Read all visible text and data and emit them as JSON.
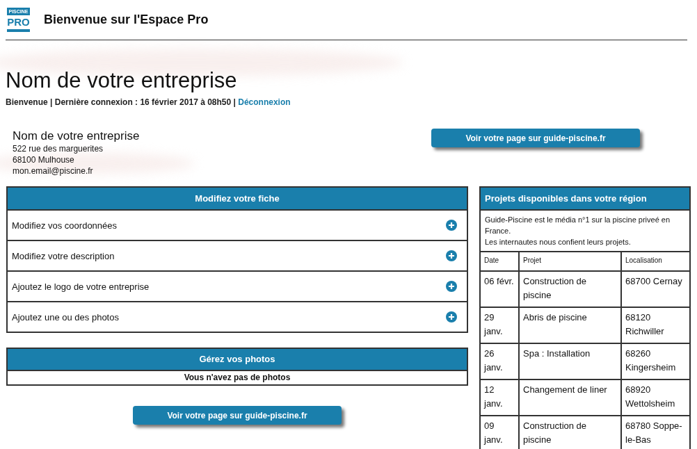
{
  "logo": {
    "top": "PISCINE",
    "bottom": "PRO"
  },
  "header": {
    "title": "Bienvenue sur l'Espace Pro"
  },
  "page": {
    "title": "Nom de votre entreprise",
    "login_info": "Bienvenue | Dernière connexion : 16 février 2017 à 08h50 |",
    "logout": "Déconnexion"
  },
  "view_button_top": "Voir votre page sur guide-piscine.fr",
  "company": {
    "name": "Nom de votre entreprise",
    "address": "522 rue des marguerites",
    "city": "68100 Mulhouse",
    "email": "mon.email@piscine.fr"
  },
  "fiche": {
    "title": "Modifiez votre fiche",
    "items": [
      {
        "label": "Modifiez vos coordonnées"
      },
      {
        "label": "Modifiez votre description"
      },
      {
        "label": "Ajoutez le logo de votre entreprise"
      },
      {
        "label": "Ajoutez une ou des photos"
      }
    ]
  },
  "photos": {
    "title": "Gérez vos photos",
    "message": "Vous n'avez pas de photos"
  },
  "view_button_bottom": "Voir votre page sur guide-piscine.fr",
  "projects": {
    "title": "Projets disponibles dans votre région",
    "intro": [
      "Guide-Piscine est le média n°1 sur la piscine priveé en France.",
      "Les internautes nous confient leurs projets."
    ],
    "columns": [
      "Date",
      "Projet",
      "Localisation"
    ],
    "rows": [
      [
        "06 févr.",
        "Construction de piscine",
        "68700 Cernay"
      ],
      [
        "29 janv.",
        "Abris de piscine",
        "68120 Richwiller"
      ],
      [
        "26 janv.",
        "Spa : Installation",
        "68260 Kingersheim"
      ],
      [
        "12 janv.",
        "Changement de liner",
        "68920 Wettolsheim"
      ],
      [
        "09 janv.",
        "Construction de piscine",
        "68780 Soppe-le-Bas"
      ]
    ]
  }
}
